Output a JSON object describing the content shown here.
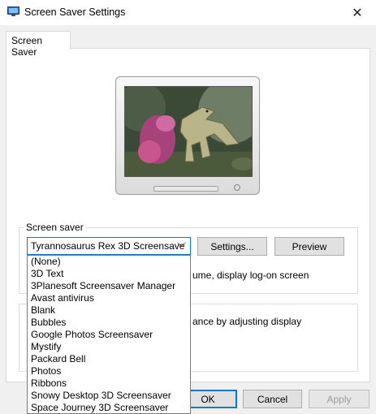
{
  "window": {
    "title": "Screen Saver Settings",
    "close_glyph": "✕"
  },
  "tabs": [
    {
      "label": "Screen Saver"
    }
  ],
  "screensaver_group": {
    "label": "Screen saver",
    "selected": "Tyrannosaurus Rex 3D Screensave",
    "settings_label": "Settings...",
    "preview_label": "Preview",
    "partial_text": "ume, display log-on screen"
  },
  "power_group": {
    "partial_text": "ance by adjusting display"
  },
  "dropdown": {
    "options": [
      "(None)",
      "3D Text",
      "3Planesoft Screensaver Manager",
      "Avast antivirus",
      "Blank",
      "Bubbles",
      "Google Photos Screensaver",
      "Mystify",
      "Packard Bell",
      "Photos",
      "Ribbons",
      "Snowy Desktop 3D Screensaver",
      "Space Journey 3D Screensaver"
    ]
  },
  "footer": {
    "ok_label": "OK",
    "cancel_label": "Cancel",
    "apply_label": "Apply"
  },
  "colors": {
    "accent": "#0078d7",
    "window_bg": "#f0f0f0",
    "panel_bg": "#ffffff"
  }
}
